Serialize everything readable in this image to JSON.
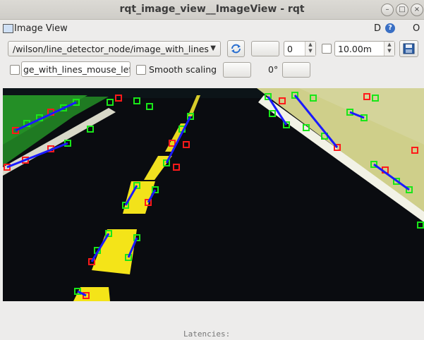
{
  "window": {
    "title": "rqt_image_view__ImageView - rqt",
    "controls": [
      "minimize",
      "maximize",
      "close"
    ]
  },
  "plugin": {
    "title": "Image View",
    "d_label": "D",
    "help_icon": "help-icon",
    "close_label": "O"
  },
  "toolbar": {
    "topic": "/wilson/line_detector_node/image_with_lines",
    "refresh_icon": "refresh-icon",
    "spin_value": "0",
    "max_range": "10.00m",
    "save_icon": "save-icon",
    "mouse_topic": "ge_with_lines_mouse_left",
    "smooth_label": "Smooth scaling",
    "rotation_label": "0°"
  },
  "terminal": {
    "partial_text": "Latencies:"
  },
  "colors": {
    "road": "#0a0c10",
    "grass": "#1f8a1f",
    "line_yellow": "#f2e21a",
    "edge_white": "#eeeedd",
    "marker_red": "#ff1a1a",
    "marker_green": "#19e619",
    "marker_blue": "#1a1aff"
  }
}
